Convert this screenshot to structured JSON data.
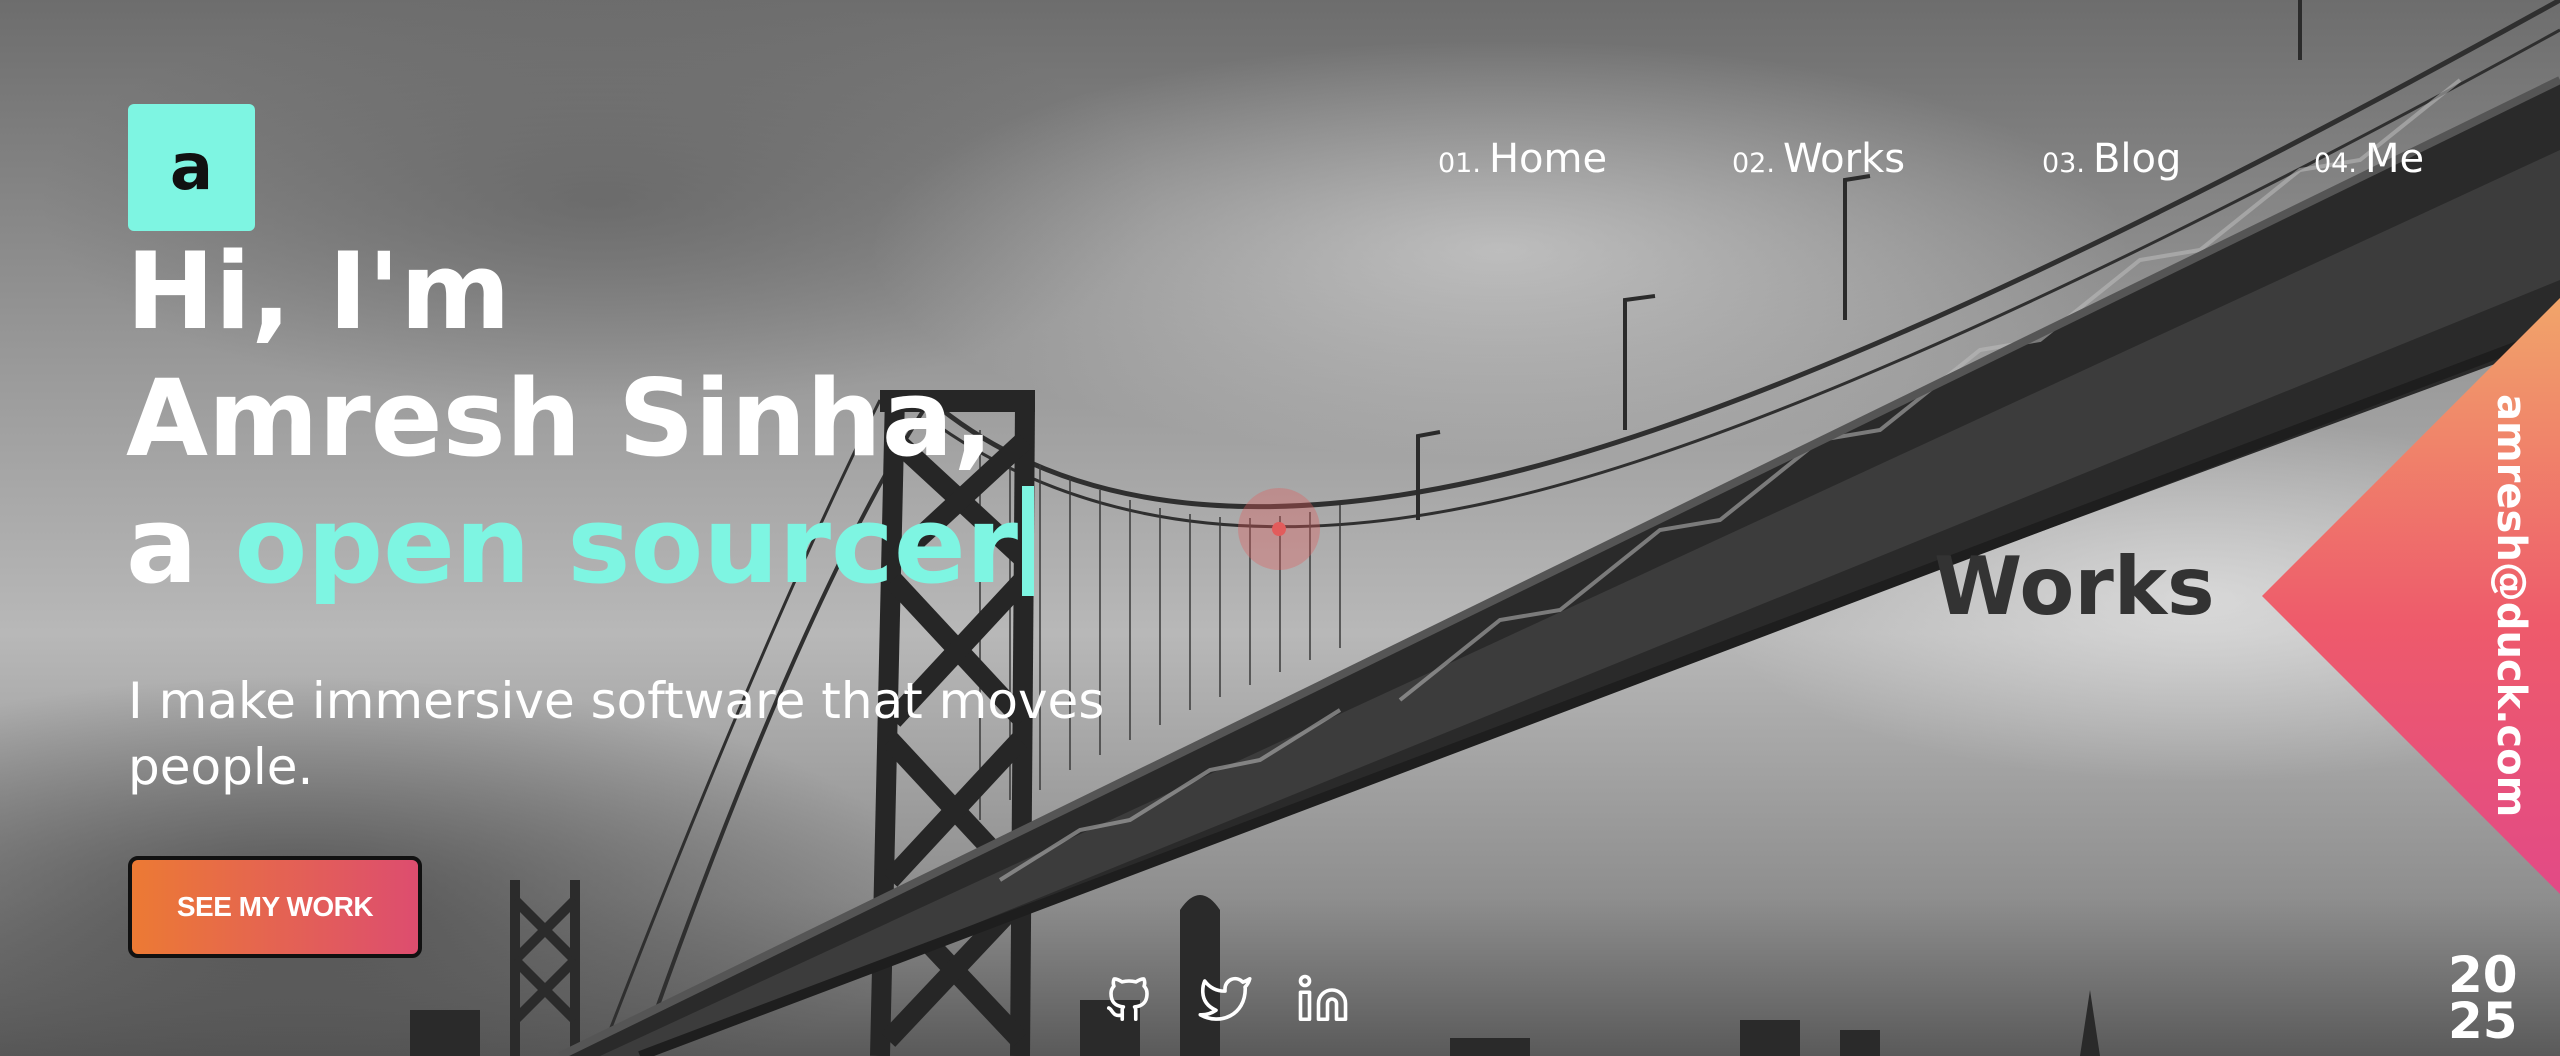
{
  "logo": {
    "letter": "a"
  },
  "nav": [
    {
      "num": "01.",
      "label": "Home"
    },
    {
      "num": "02.",
      "label": "Works"
    },
    {
      "num": "03.",
      "label": "Blog"
    },
    {
      "num": "04.",
      "label": "Me"
    }
  ],
  "hero": {
    "line1": "Hi, I'm",
    "line2": "Amresh Sinha,",
    "line3_prefix": "a ",
    "line3_accent": "open sourcer",
    "tagline": "I make immersive software that moves people.",
    "cta_label": "SEE MY WORK"
  },
  "section_label": "Works",
  "email": "amresh@duck.com",
  "year": {
    "top": "20",
    "bottom": "25"
  },
  "social": [
    {
      "icon": "github-icon"
    },
    {
      "icon": "twitter-icon"
    },
    {
      "icon": "linkedin-icon"
    }
  ],
  "colors": {
    "accent": "#7ef5e2",
    "cta_start": "#ec7a34",
    "cta_end": "#dd4d6f",
    "triangle_top": "#f1a56a",
    "triangle_bottom": "#e24a86"
  }
}
